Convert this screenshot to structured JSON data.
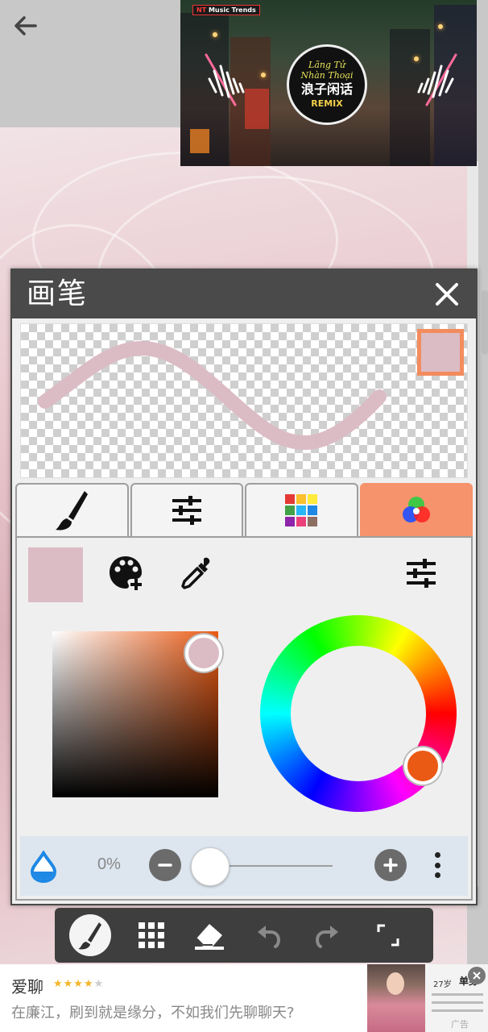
{
  "video": {
    "brand_prefix": "NT",
    "brand": "Music Trends",
    "disc_line1": "Lãng Tử",
    "disc_line2": "Nhàn Thoại",
    "disc_title": "浪子闲话",
    "disc_tag": "REMIX"
  },
  "panel": {
    "title": "画笔",
    "current_color": "#dbbcc5",
    "hue_color": "#ea5a14",
    "tabs": [
      {
        "name": "brush",
        "active": false
      },
      {
        "name": "settings",
        "active": false
      },
      {
        "name": "palette",
        "active": false
      },
      {
        "name": "color",
        "active": true
      }
    ],
    "opacity_label": "0%",
    "opacity_value": 0
  },
  "toolbar": {
    "items": [
      "brush",
      "grid",
      "eraser",
      "undo",
      "redo",
      "fullscreen"
    ],
    "active": "brush"
  },
  "ad": {
    "name": "爱聊",
    "stars": "★★★★",
    "star_empty": "★",
    "text": "在廉江，刷到就是缘分，不如我们先聊聊天?",
    "age": "27岁",
    "single": "单身",
    "tag": "广告"
  },
  "colors": {
    "accent": "#f6936d",
    "header": "#4a4a4a",
    "preview_stroke": "#dbbcc5"
  }
}
